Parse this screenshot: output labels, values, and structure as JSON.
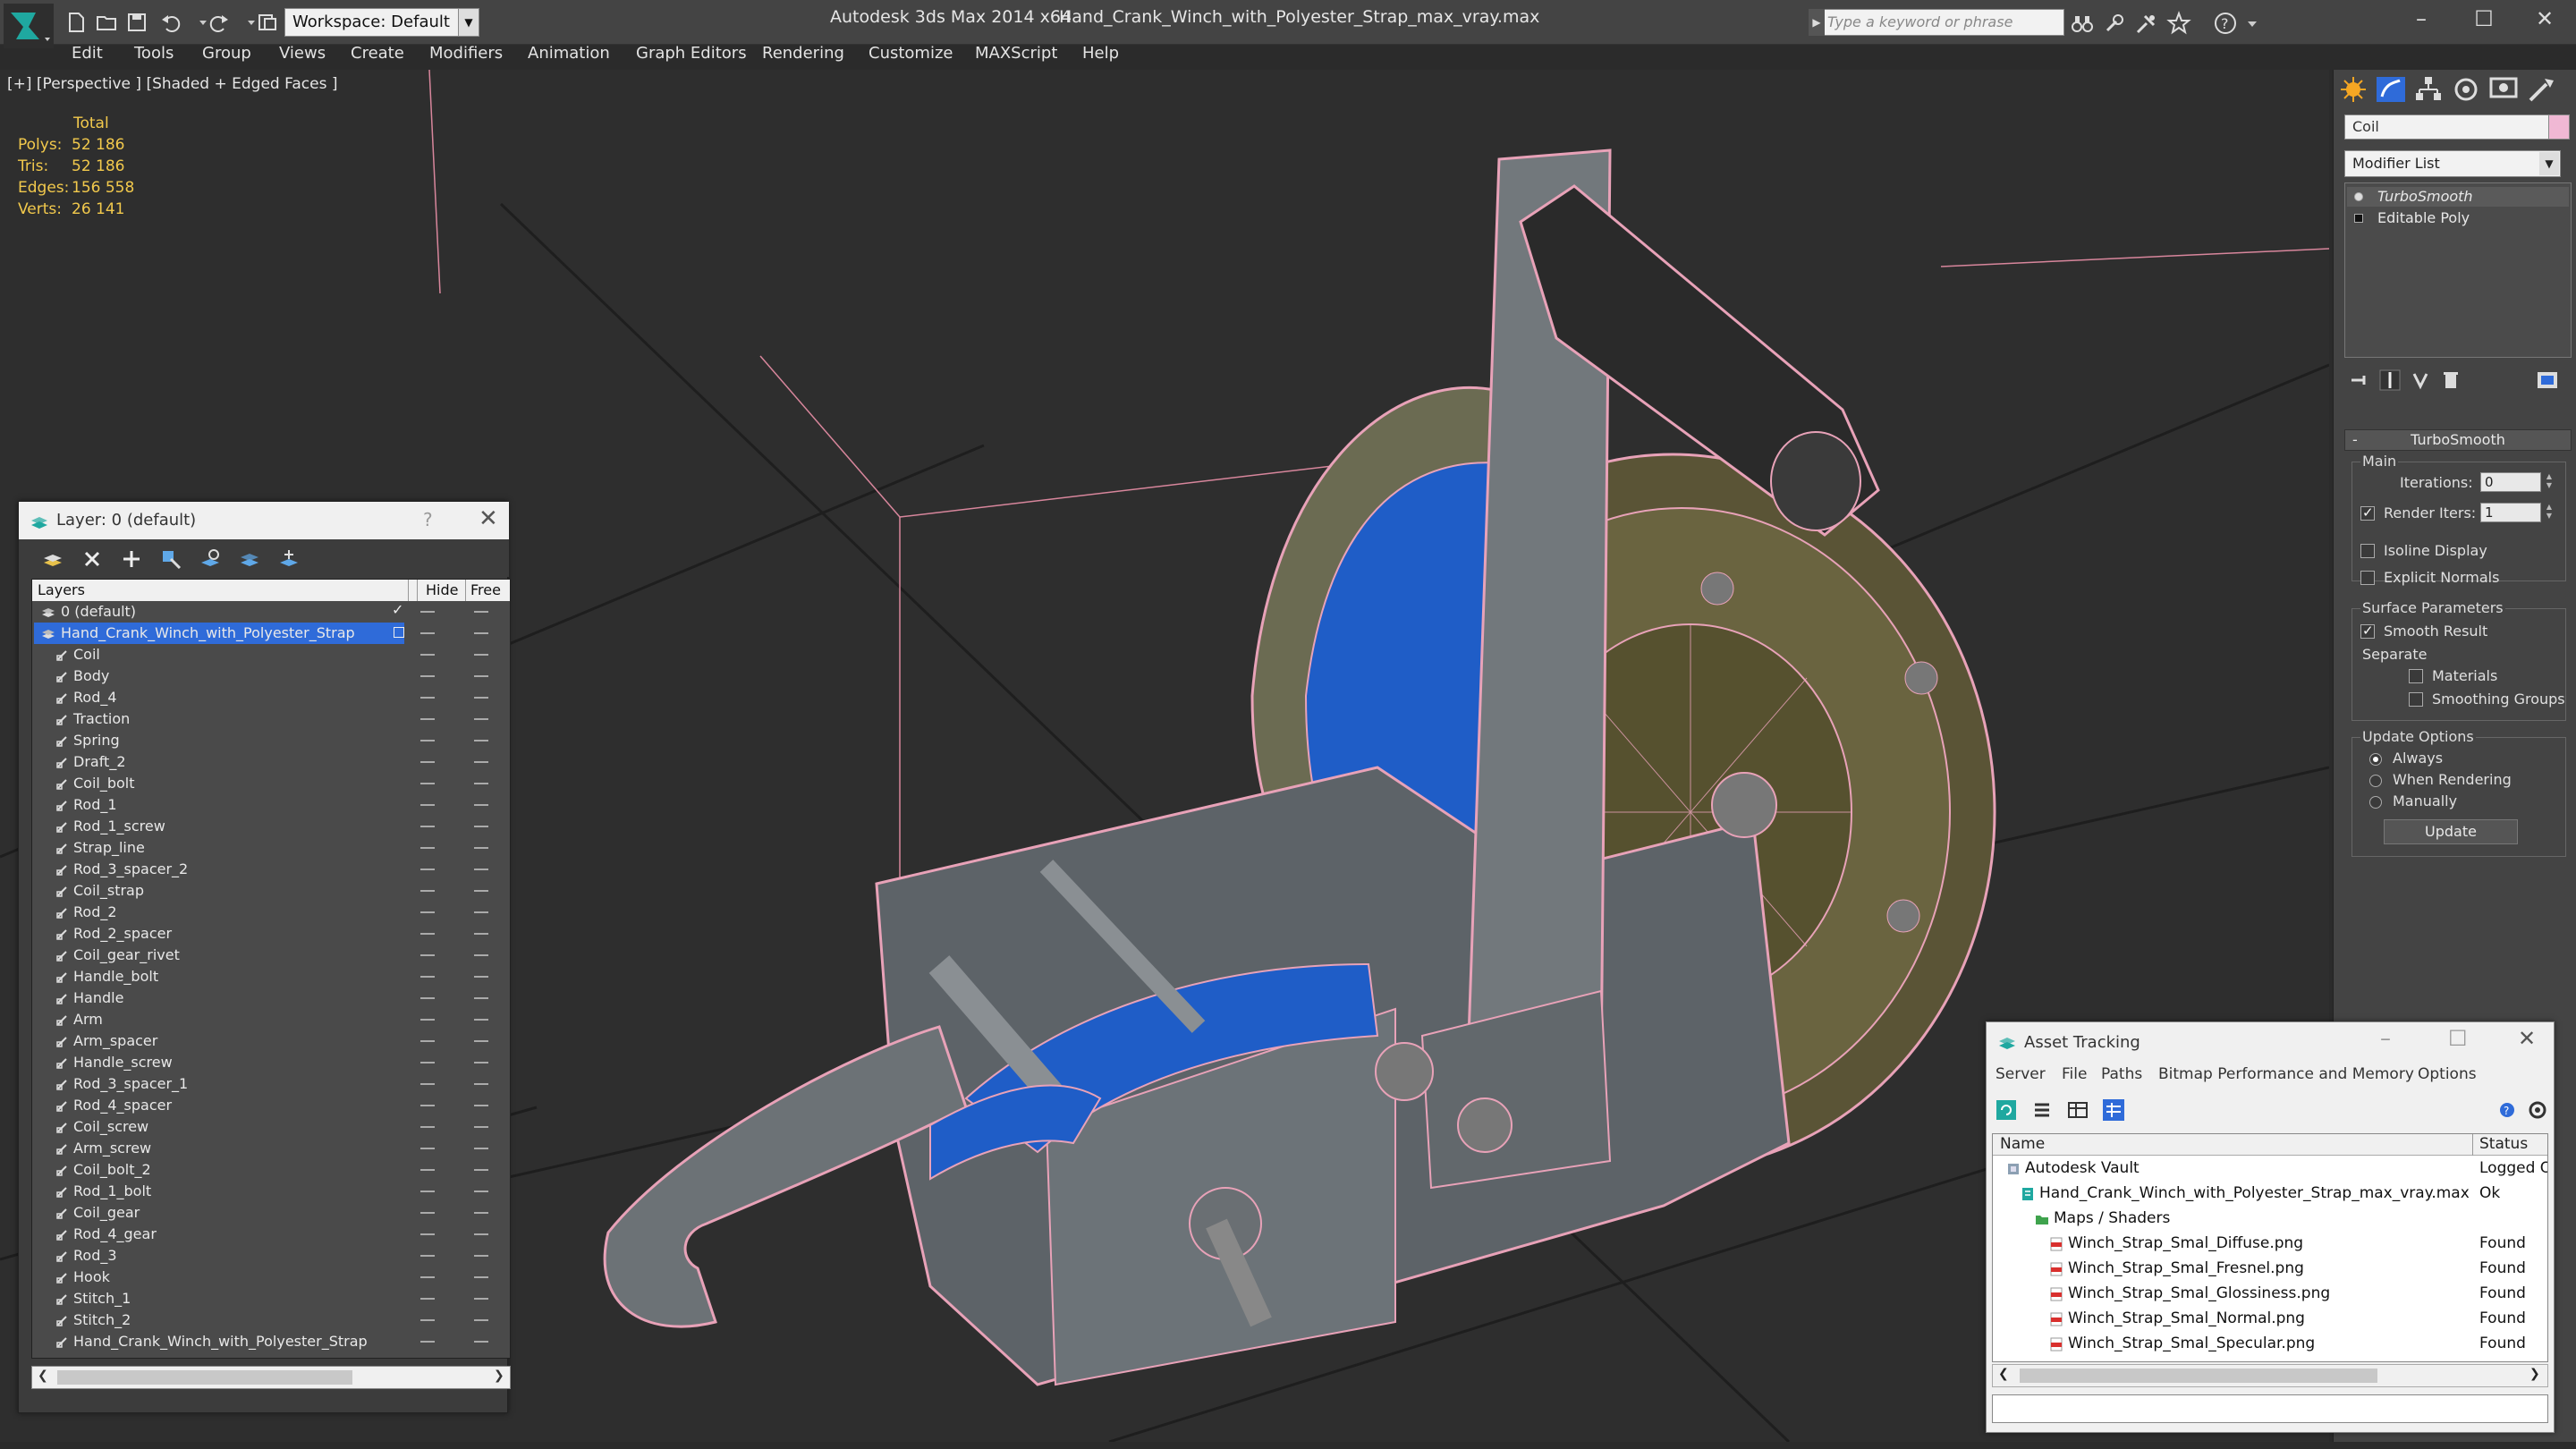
{
  "titlebar": {
    "workspace": "Workspace: Default",
    "app_title": "Autodesk 3ds Max  2014 x64",
    "file_title": "Hand_Crank_Winch_with_Polyester_Strap_max_vray.max",
    "search_placeholder": "Type a keyword or phrase",
    "minimize": "–",
    "maximize": "☐",
    "close": "✕"
  },
  "menu": [
    "Edit",
    "Tools",
    "Group",
    "Views",
    "Create",
    "Modifiers",
    "Animation",
    "Graph Editors",
    "Rendering",
    "Customize",
    "MAXScript",
    "Help"
  ],
  "viewport": {
    "label": "[+] [Perspective ] [Shaded + Edged Faces ]",
    "stats": {
      "total_label": "Total",
      "rows": [
        {
          "k": "Polys:",
          "v": "52 186"
        },
        {
          "k": "Tris:",
          "v": "52 186"
        },
        {
          "k": "Edges:",
          "v": "156 558"
        },
        {
          "k": "Verts:",
          "v": "26 141"
        }
      ]
    }
  },
  "layer_window": {
    "title": "Layer: 0 (default)",
    "help": "?",
    "close": "✕",
    "col_layers": "Layers",
    "col_hide": "Hide",
    "col_free": "Free",
    "layers": [
      {
        "name": "0 (default)",
        "level": 0,
        "type": "layer",
        "check": true
      },
      {
        "name": "Hand_Crank_Winch_with_Polyester_Strap",
        "level": 0,
        "type": "layer",
        "selected": true
      },
      {
        "name": "Coil",
        "level": 1,
        "type": "object"
      },
      {
        "name": "Body",
        "level": 1,
        "type": "object"
      },
      {
        "name": "Rod_4",
        "level": 1,
        "type": "object"
      },
      {
        "name": "Traction",
        "level": 1,
        "type": "object"
      },
      {
        "name": "Spring",
        "level": 1,
        "type": "object"
      },
      {
        "name": "Draft_2",
        "level": 1,
        "type": "object"
      },
      {
        "name": "Coil_bolt",
        "level": 1,
        "type": "object"
      },
      {
        "name": "Rod_1",
        "level": 1,
        "type": "object"
      },
      {
        "name": "Rod_1_screw",
        "level": 1,
        "type": "object"
      },
      {
        "name": "Strap_line",
        "level": 1,
        "type": "object"
      },
      {
        "name": "Rod_3_spacer_2",
        "level": 1,
        "type": "object"
      },
      {
        "name": "Coil_strap",
        "level": 1,
        "type": "object"
      },
      {
        "name": "Rod_2",
        "level": 1,
        "type": "object"
      },
      {
        "name": "Rod_2_spacer",
        "level": 1,
        "type": "object"
      },
      {
        "name": "Coil_gear_rivet",
        "level": 1,
        "type": "object"
      },
      {
        "name": "Handle_bolt",
        "level": 1,
        "type": "object"
      },
      {
        "name": "Handle",
        "level": 1,
        "type": "object"
      },
      {
        "name": "Arm",
        "level": 1,
        "type": "object"
      },
      {
        "name": "Arm_spacer",
        "level": 1,
        "type": "object"
      },
      {
        "name": "Handle_screw",
        "level": 1,
        "type": "object"
      },
      {
        "name": "Rod_3_spacer_1",
        "level": 1,
        "type": "object"
      },
      {
        "name": "Rod_4_spacer",
        "level": 1,
        "type": "object"
      },
      {
        "name": "Coil_screw",
        "level": 1,
        "type": "object"
      },
      {
        "name": "Arm_screw",
        "level": 1,
        "type": "object"
      },
      {
        "name": "Coil_bolt_2",
        "level": 1,
        "type": "object"
      },
      {
        "name": "Rod_1_bolt",
        "level": 1,
        "type": "object"
      },
      {
        "name": "Coil_gear",
        "level": 1,
        "type": "object"
      },
      {
        "name": "Rod_4_gear",
        "level": 1,
        "type": "object"
      },
      {
        "name": "Rod_3",
        "level": 1,
        "type": "object"
      },
      {
        "name": "Hook",
        "level": 1,
        "type": "object"
      },
      {
        "name": "Stitch_1",
        "level": 1,
        "type": "object"
      },
      {
        "name": "Stitch_2",
        "level": 1,
        "type": "object"
      },
      {
        "name": "Hand_Crank_Winch_with_Polyester_Strap",
        "level": 1,
        "type": "object"
      }
    ]
  },
  "command_panel": {
    "object_name": "Coil",
    "object_color": "#f0b8d4",
    "modifier_list": "Modifier List",
    "stack": [
      "TurboSmooth",
      "Editable Poly"
    ],
    "rollout": "TurboSmooth",
    "main_group": "Main",
    "iterations_label": "Iterations:",
    "iterations_value": "0",
    "render_iters_label": "Render Iters:",
    "render_iters_value": "1",
    "render_iters_checked": true,
    "isoline_label": "Isoline Display",
    "explicit_normals_label": "Explicit Normals",
    "surface_group": "Surface Parameters",
    "smooth_result_label": "Smooth Result",
    "separate_label": "Separate",
    "materials_label": "Materials",
    "smoothing_groups_label": "Smoothing Groups",
    "update_group": "Update Options",
    "always_label": "Always",
    "when_rendering_label": "When Rendering",
    "manually_label": "Manually",
    "update_button": "Update"
  },
  "asset_tracking": {
    "title": "Asset Tracking",
    "menu": [
      "Server",
      "File",
      "Paths",
      "Bitmap Performance and Memory",
      "Options"
    ],
    "col_name": "Name",
    "col_status": "Status",
    "rows": [
      {
        "name": "Autodesk Vault",
        "status": "Logged O",
        "level": 0,
        "icon": "vault"
      },
      {
        "name": "Hand_Crank_Winch_with_Polyester_Strap_max_vray.max",
        "status": "Ok",
        "level": 1,
        "icon": "max-file"
      },
      {
        "name": "Maps / Shaders",
        "status": "",
        "level": 2,
        "icon": "folder"
      },
      {
        "name": "Winch_Strap_Smal_Diffuse.png",
        "status": "Found",
        "level": 3,
        "icon": "png"
      },
      {
        "name": "Winch_Strap_Smal_Fresnel.png",
        "status": "Found",
        "level": 3,
        "icon": "png"
      },
      {
        "name": "Winch_Strap_Smal_Glossiness.png",
        "status": "Found",
        "level": 3,
        "icon": "png"
      },
      {
        "name": "Winch_Strap_Smal_Normal.png",
        "status": "Found",
        "level": 3,
        "icon": "png"
      },
      {
        "name": "Winch_Strap_Smal_Specular.png",
        "status": "Found",
        "level": 3,
        "icon": "png"
      }
    ]
  }
}
